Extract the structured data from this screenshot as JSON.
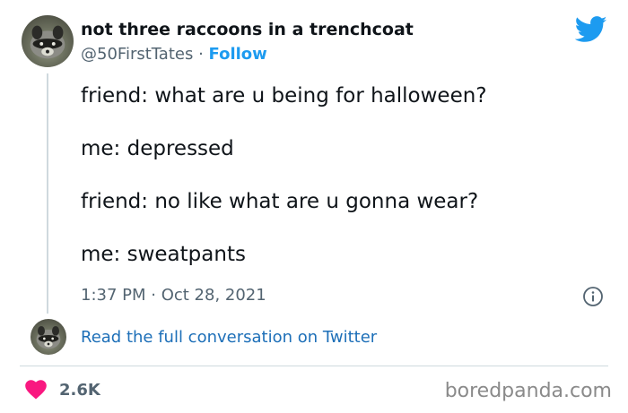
{
  "author": {
    "name": "not three raccoons in a trenchcoat",
    "handle": "@50FirstTates",
    "separator": " · ",
    "follow_label": "Follow"
  },
  "icons": {
    "brand": "twitter-bird-icon",
    "info": "info-icon",
    "like": "heart-icon",
    "avatar": "raccoon-avatar"
  },
  "tweet": {
    "lines": [
      "friend: what are u being for halloween?",
      "me: depressed",
      "friend: no like what are u gonna wear?",
      "me: sweatpants"
    ],
    "timestamp": "1:37 PM · Oct 28, 2021"
  },
  "conversation": {
    "link_label": "Read the full conversation on Twitter"
  },
  "engagement": {
    "likes": "2.6K"
  },
  "watermark": "boredpanda.com",
  "colors": {
    "accent": "#1d9bf0",
    "link": "#1d6fb8",
    "like": "#f91880",
    "secondary_text": "#536471"
  }
}
